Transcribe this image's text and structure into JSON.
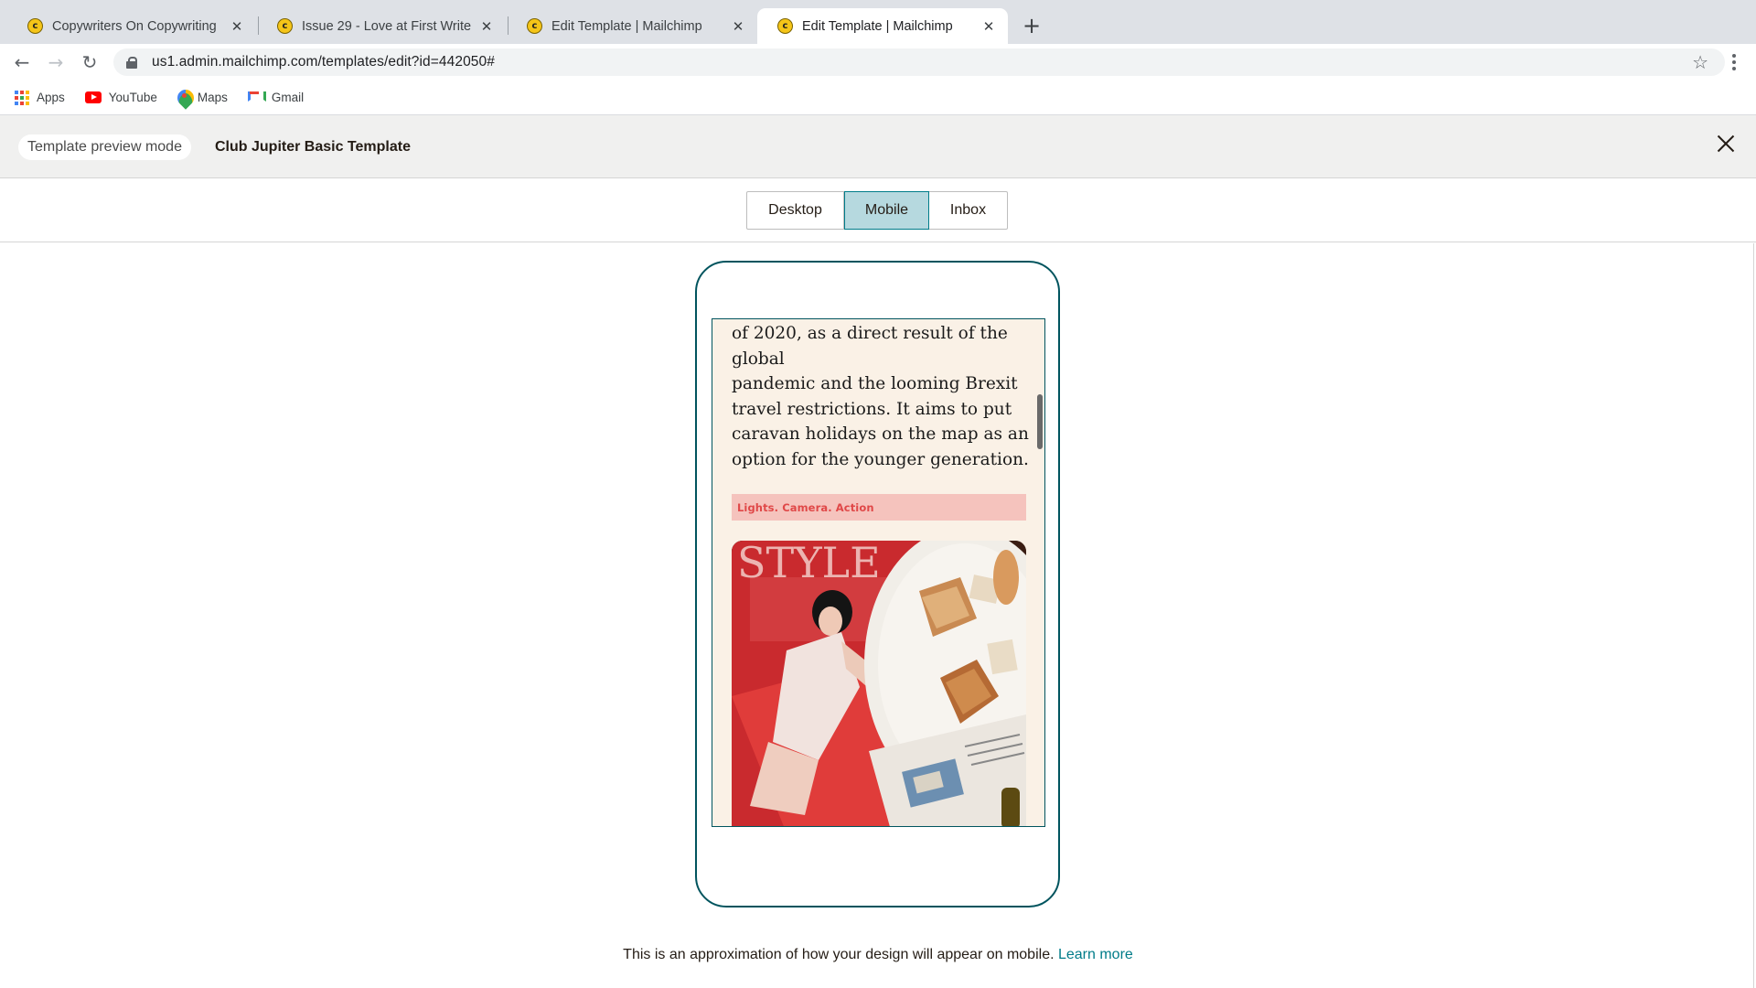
{
  "browser": {
    "tabs": [
      {
        "title": "Copywriters On Copywriting",
        "active": false
      },
      {
        "title": "Issue 29 - Love at First Write",
        "active": false
      },
      {
        "title": "Edit Template | Mailchimp",
        "active": false
      },
      {
        "title": "Edit Template | Mailchimp",
        "active": true
      }
    ],
    "url": "us1.admin.mailchimp.com/templates/edit?id=442050#",
    "bookmarks": [
      "Apps",
      "YouTube",
      "Maps",
      "Gmail"
    ]
  },
  "preview": {
    "mode_label": "Template preview mode",
    "template_name": "Club Jupiter Basic Template",
    "views": [
      "Desktop",
      "Mobile",
      "Inbox"
    ],
    "selected_view": "Mobile"
  },
  "email": {
    "paragraph_lines": [
      "of 2020, as a direct result of the global",
      "pandemic and the looming Brexit",
      "travel restrictions. It aims to put",
      "caravan holidays on the map as an",
      "option for the younger generation."
    ],
    "section_heading": "Lights. Camera. Action"
  },
  "footer": {
    "note": "This is an approximation of how your design will appear on mobile.",
    "link": "Learn more"
  },
  "colors": {
    "accent_teal": "#007c89",
    "phone_frame": "#00545e",
    "email_background": "#faf1e6",
    "section_band": "#f5c3bd",
    "section_text": "#e04848"
  },
  "icons": [
    "mailchimp-favicon",
    "close-tab-icon",
    "new-tab-icon",
    "back-icon",
    "forward-icon",
    "reload-icon",
    "lock-icon",
    "star-icon",
    "menu-icon",
    "apps-icon",
    "youtube-icon",
    "maps-icon",
    "gmail-icon",
    "close-icon"
  ]
}
